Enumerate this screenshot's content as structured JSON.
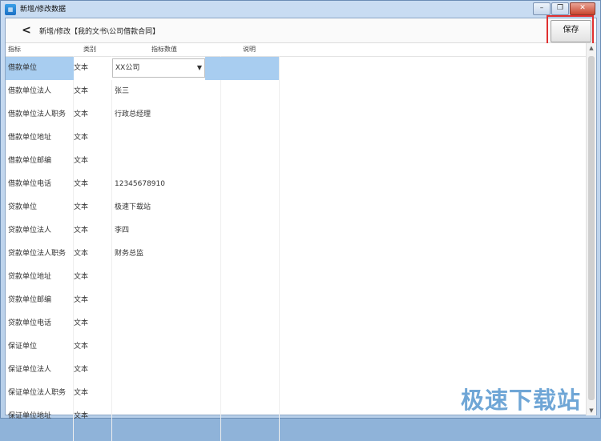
{
  "window": {
    "title": "新增/修改数据",
    "icon": "app-icon",
    "controls": [
      "minimize",
      "restore",
      "close"
    ]
  },
  "toolbar": {
    "back_label": "<",
    "breadcrumb": "新增/修改【我的文书\\公司借款合同】",
    "save_label": "保存"
  },
  "grid": {
    "headers": [
      "指标",
      "类别",
      "指标数值",
      "说明"
    ],
    "rows": [
      {
        "name": "借款单位",
        "type": "文本",
        "value": "XX公司",
        "note": ""
      },
      {
        "name": "借款单位法人",
        "type": "文本",
        "value": "张三",
        "note": ""
      },
      {
        "name": "借款单位法人职务",
        "type": "文本",
        "value": "行政总经理",
        "note": ""
      },
      {
        "name": "借款单位地址",
        "type": "文本",
        "value": "",
        "note": ""
      },
      {
        "name": "借款单位邮编",
        "type": "文本",
        "value": "",
        "note": ""
      },
      {
        "name": "借款单位电话",
        "type": "文本",
        "value": "12345678910",
        "note": ""
      },
      {
        "name": "贷款单位",
        "type": "文本",
        "value": "极速下载站",
        "note": ""
      },
      {
        "name": "贷款单位法人",
        "type": "文本",
        "value": "李四",
        "note": ""
      },
      {
        "name": "贷款单位法人职务",
        "type": "文本",
        "value": "财务总监",
        "note": ""
      },
      {
        "name": "贷款单位地址",
        "type": "文本",
        "value": "",
        "note": ""
      },
      {
        "name": "贷款单位邮编",
        "type": "文本",
        "value": "",
        "note": ""
      },
      {
        "name": "贷款单位电话",
        "type": "文本",
        "value": "",
        "note": ""
      },
      {
        "name": "保证单位",
        "type": "文本",
        "value": "",
        "note": ""
      },
      {
        "name": "保证单位法人",
        "type": "文本",
        "value": "",
        "note": ""
      },
      {
        "name": "保证单位法人职务",
        "type": "文本",
        "value": "",
        "note": ""
      },
      {
        "name": "保证单位地址",
        "type": "文本",
        "value": "",
        "note": ""
      }
    ],
    "selected_index": 0
  },
  "watermark": "极速下载站",
  "colors": {
    "selection": "#a8cdf0",
    "highlight_border": "#e03030",
    "watermark": "#6fa6d6"
  }
}
